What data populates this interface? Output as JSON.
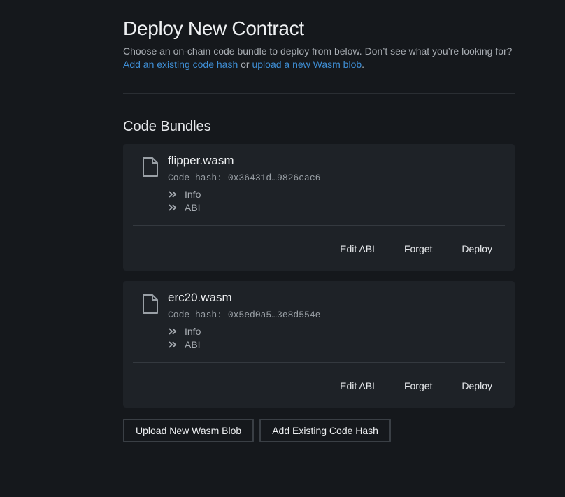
{
  "header": {
    "title": "Deploy New Contract",
    "intro_text": "Choose an on-chain code bundle to deploy from below. Don’t see what you’re looking for? ",
    "link_add_hash": "Add an existing code hash",
    "or_text": " or ",
    "link_upload": "upload a new Wasm blob",
    "period": "."
  },
  "section": {
    "title": "Code Bundles"
  },
  "bundles": [
    {
      "name": "flipper.wasm",
      "code_hash": "Code hash: 0x36431d…9826cac6",
      "info_label": "Info",
      "abi_label": "ABI",
      "edit_abi_label": "Edit ABI",
      "forget_label": "Forget",
      "deploy_label": "Deploy"
    },
    {
      "name": "erc20.wasm",
      "code_hash": "Code hash: 0x5ed0a5…3e8d554e",
      "info_label": "Info",
      "abi_label": "ABI",
      "edit_abi_label": "Edit ABI",
      "forget_label": "Forget",
      "deploy_label": "Deploy"
    }
  ],
  "footer_buttons": {
    "upload_label": "Upload New Wasm Blob",
    "add_hash_label": "Add Existing Code Hash"
  },
  "icons": {
    "file": "file-icon",
    "expand": "chevron-double-right-icon"
  },
  "colors": {
    "background": "#15181c",
    "card": "#1e2227",
    "link": "#3f8fd6"
  }
}
